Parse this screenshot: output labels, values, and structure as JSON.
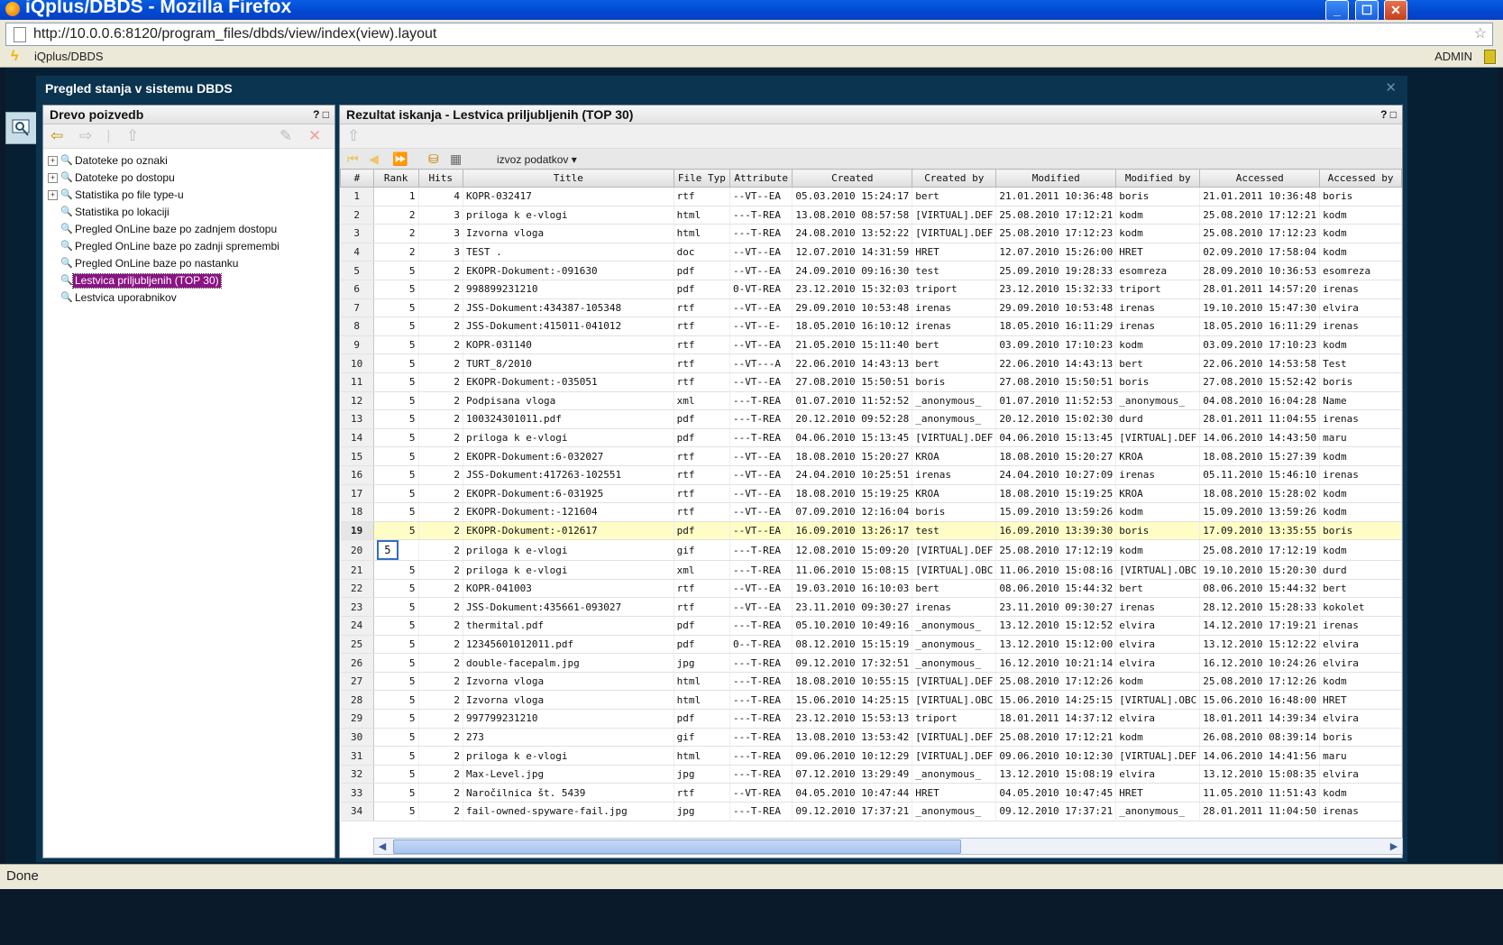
{
  "window": {
    "title": "iQplus/DBDS - Mozilla Firefox"
  },
  "browser": {
    "url": "http://10.0.0.6:8120/program_files/dbds/view/index(view).layout",
    "app_label": "iQplus/DBDS",
    "user": "ADMIN",
    "status": "Done"
  },
  "main_window": {
    "title": "Pregled stanja v sistemu DBDS"
  },
  "left_panel": {
    "title": "Drevo poizvedb",
    "help": "?",
    "items": [
      {
        "label": "Datoteke po oznaki",
        "expandable": "+"
      },
      {
        "label": "Datoteke po dostopu",
        "expandable": "+"
      },
      {
        "label": "Statistika po file type-u",
        "expandable": "+"
      },
      {
        "label": "Statistika po lokaciji",
        "expandable": ""
      },
      {
        "label": "Pregled OnLine baze po zadnjem dostopu",
        "expandable": ""
      },
      {
        "label": "Pregled OnLine baze po zadnji spremembi",
        "expandable": ""
      },
      {
        "label": "Pregled OnLine baze po nastanku",
        "expandable": ""
      },
      {
        "label": "Lestvica priljubljenih (TOP 30)",
        "expandable": ""
      },
      {
        "label": "Lestvica uporabnikov",
        "expandable": ""
      }
    ],
    "selected_index": 7
  },
  "right_panel": {
    "title": "Rezultat iskanja - Lestvica priljubljenih (TOP 30)",
    "help": "?",
    "export_label": "izvoz podatkov"
  },
  "grid": {
    "columns": [
      "#",
      "Rank",
      "Hits",
      "Title",
      "File Typ",
      "Attribute",
      "Created",
      "Created by",
      "Modified",
      "Modified by",
      "Accessed",
      "Accessed by"
    ],
    "highlight_row": 19,
    "focus_row": 20,
    "rows": [
      [
        "1",
        "1",
        "4",
        "KOPR-032417",
        "rtf",
        "--VT--EA",
        "05.03.2010 15:24:17",
        "bert",
        "21.01.2011 10:36:48",
        "boris",
        "21.01.2011 10:36:48",
        "boris"
      ],
      [
        "2",
        "2",
        "3",
        "priloga k e-vlogi",
        "html",
        "---T-REA",
        "13.08.2010 08:57:58",
        "[VIRTUAL].DEF",
        "25.08.2010 17:12:21",
        "kodm",
        "25.08.2010 17:12:21",
        "kodm"
      ],
      [
        "3",
        "2",
        "3",
        "Izvorna vloga",
        "html",
        "---T-REA",
        "24.08.2010 13:52:22",
        "[VIRTUAL].DEF",
        "25.08.2010 17:12:23",
        "kodm",
        "25.08.2010 17:12:23",
        "kodm"
      ],
      [
        "4",
        "2",
        "3",
        "TEST .",
        "doc",
        "--VT--EA",
        "12.07.2010 14:31:59",
        "HRET",
        "12.07.2010 15:26:00",
        "HRET",
        "02.09.2010 17:58:04",
        "kodm"
      ],
      [
        "5",
        "5",
        "2",
        "EKOPR-Dokument:-091630",
        "pdf",
        "--VT--EA",
        "24.09.2010 09:16:30",
        "test",
        "25.09.2010 19:28:33",
        "esomreza",
        "28.09.2010 10:36:53",
        "esomreza"
      ],
      [
        "6",
        "5",
        "2",
        "998899231210",
        "pdf",
        "0-VT-REA",
        "23.12.2010 15:32:03",
        "triport",
        "23.12.2010 15:32:33",
        "triport",
        "28.01.2011 14:57:20",
        "irenas"
      ],
      [
        "7",
        "5",
        "2",
        "JSS-Dokument:434387-105348",
        "rtf",
        "--VT--EA",
        "29.09.2010 10:53:48",
        "irenas",
        "29.09.2010 10:53:48",
        "irenas",
        "19.10.2010 15:47:30",
        "elvira"
      ],
      [
        "8",
        "5",
        "2",
        "JSS-Dokument:415011-041012",
        "rtf",
        "--VT--E-",
        "18.05.2010 16:10:12",
        "irenas",
        "18.05.2010 16:11:29",
        "irenas",
        "18.05.2010 16:11:29",
        "irenas"
      ],
      [
        "9",
        "5",
        "2",
        "KOPR-031140",
        "rtf",
        "--VT--EA",
        "21.05.2010 15:11:40",
        "bert",
        "03.09.2010 17:10:23",
        "kodm",
        "03.09.2010 17:10:23",
        "kodm"
      ],
      [
        "10",
        "5",
        "2",
        "TURT_8/2010",
        "rtf",
        "--VT---A",
        "22.06.2010 14:43:13",
        "bert",
        "22.06.2010 14:43:13",
        "bert",
        "22.06.2010 14:53:58",
        "Test"
      ],
      [
        "11",
        "5",
        "2",
        "EKOPR-Dokument:-035051",
        "rtf",
        "--VT--EA",
        "27.08.2010 15:50:51",
        "boris",
        "27.08.2010 15:50:51",
        "boris",
        "27.08.2010 15:52:42",
        "boris"
      ],
      [
        "12",
        "5",
        "2",
        "Podpisana vloga",
        "xml",
        "---T-REA",
        "01.07.2010 11:52:52",
        "_anonymous_",
        "01.07.2010 11:52:53",
        "_anonymous_",
        "04.08.2010 16:04:28",
        "Name"
      ],
      [
        "13",
        "5",
        "2",
        "100324301011.pdf",
        "pdf",
        "---T-REA",
        "20.12.2010 09:52:28",
        "_anonymous_",
        "20.12.2010 15:02:30",
        "durd",
        "28.01.2011 11:04:55",
        "irenas"
      ],
      [
        "14",
        "5",
        "2",
        "priloga k e-vlogi",
        "pdf",
        "---T-REA",
        "04.06.2010 15:13:45",
        "[VIRTUAL].DEF",
        "04.06.2010 15:13:45",
        "[VIRTUAL].DEF",
        "14.06.2010 14:43:50",
        "maru"
      ],
      [
        "15",
        "5",
        "2",
        "EKOPR-Dokument:6-032027",
        "rtf",
        "--VT--EA",
        "18.08.2010 15:20:27",
        "KROA",
        "18.08.2010 15:20:27",
        "KROA",
        "18.08.2010 15:27:39",
        "kodm"
      ],
      [
        "16",
        "5",
        "2",
        "JSS-Dokument:417263-102551",
        "rtf",
        "--VT--EA",
        "24.04.2010 10:25:51",
        "irenas",
        "24.04.2010 10:27:09",
        "irenas",
        "05.11.2010 15:46:10",
        "irenas"
      ],
      [
        "17",
        "5",
        "2",
        "EKOPR-Dokument:6-031925",
        "rtf",
        "--VT--EA",
        "18.08.2010 15:19:25",
        "KROA",
        "18.08.2010 15:19:25",
        "KROA",
        "18.08.2010 15:28:02",
        "kodm"
      ],
      [
        "18",
        "5",
        "2",
        "EKOPR-Dokument:-121604",
        "rtf",
        "--VT--EA",
        "07.09.2010 12:16:04",
        "boris",
        "15.09.2010 13:59:26",
        "kodm",
        "15.09.2010 13:59:26",
        "kodm"
      ],
      [
        "19",
        "5",
        "2",
        "EKOPR-Dokument:-012617",
        "pdf",
        "--VT--EA",
        "16.09.2010 13:26:17",
        "test",
        "16.09.2010 13:39:30",
        "boris",
        "17.09.2010 13:35:55",
        "boris"
      ],
      [
        "20",
        "5",
        "2",
        "priloga k e-vlogi",
        "gif",
        "---T-REA",
        "12.08.2010 15:09:20",
        "[VIRTUAL].DEF",
        "25.08.2010 17:12:19",
        "kodm",
        "25.08.2010 17:12:19",
        "kodm"
      ],
      [
        "21",
        "5",
        "2",
        "priloga k e-vlogi",
        "xml",
        "---T-REA",
        "11.06.2010 15:08:15",
        "[VIRTUAL].OBC",
        "11.06.2010 15:08:16",
        "[VIRTUAL].OBC",
        "19.10.2010 15:20:30",
        "durd"
      ],
      [
        "22",
        "5",
        "2",
        "KOPR-041003",
        "rtf",
        "--VT--EA",
        "19.03.2010 16:10:03",
        "bert",
        "08.06.2010 15:44:32",
        "bert",
        "08.06.2010 15:44:32",
        "bert"
      ],
      [
        "23",
        "5",
        "2",
        "JSS-Dokument:435661-093027",
        "rtf",
        "--VT--EA",
        "23.11.2010 09:30:27",
        "irenas",
        "23.11.2010 09:30:27",
        "irenas",
        "28.12.2010 15:28:33",
        "kokolet"
      ],
      [
        "24",
        "5",
        "2",
        "thermital.pdf",
        "pdf",
        "---T-REA",
        "05.10.2010 10:49:16",
        "_anonymous_",
        "13.12.2010 15:12:52",
        "elvira",
        "14.12.2010 17:19:21",
        "irenas"
      ],
      [
        "25",
        "5",
        "2",
        "12345601012011.pdf",
        "pdf",
        "0--T-REA",
        "08.12.2010 15:15:19",
        "_anonymous_",
        "13.12.2010 15:12:00",
        "elvira",
        "13.12.2010 15:12:22",
        "elvira"
      ],
      [
        "26",
        "5",
        "2",
        "double-facepalm.jpg",
        "jpg",
        "---T-REA",
        "09.12.2010 17:32:51",
        "_anonymous_",
        "16.12.2010 10:21:14",
        "elvira",
        "16.12.2010 10:24:26",
        "elvira"
      ],
      [
        "27",
        "5",
        "2",
        "Izvorna vloga",
        "html",
        "---T-REA",
        "18.08.2010 10:55:15",
        "[VIRTUAL].DEF",
        "25.08.2010 17:12:26",
        "kodm",
        "25.08.2010 17:12:26",
        "kodm"
      ],
      [
        "28",
        "5",
        "2",
        "Izvorna vloga",
        "html",
        "---T-REA",
        "15.06.2010 14:25:15",
        "[VIRTUAL].OBC",
        "15.06.2010 14:25:15",
        "[VIRTUAL].OBC",
        "15.06.2010 16:48:00",
        "HRET"
      ],
      [
        "29",
        "5",
        "2",
        "997799231210",
        "pdf",
        "---T-REA",
        "23.12.2010 15:53:13",
        "triport",
        "18.01.2011 14:37:12",
        "elvira",
        "18.01.2011 14:39:34",
        "elvira"
      ],
      [
        "30",
        "5",
        "2",
        "273",
        "gif",
        "---T-REA",
        "13.08.2010 13:53:42",
        "[VIRTUAL].DEF",
        "25.08.2010 17:12:21",
        "kodm",
        "26.08.2010 08:39:14",
        "boris"
      ],
      [
        "31",
        "5",
        "2",
        "priloga k e-vlogi",
        "html",
        "---T-REA",
        "09.06.2010 10:12:29",
        "[VIRTUAL].DEF",
        "09.06.2010 10:12:30",
        "[VIRTUAL].DEF",
        "14.06.2010 14:41:56",
        "maru"
      ],
      [
        "32",
        "5",
        "2",
        "Max-Level.jpg",
        "jpg",
        "---T-REA",
        "07.12.2010 13:29:49",
        "_anonymous_",
        "13.12.2010 15:08:19",
        "elvira",
        "13.12.2010 15:08:35",
        "elvira"
      ],
      [
        "33",
        "5",
        "2",
        "Naročilnica št. 5439",
        "rtf",
        "--VT-REA",
        "04.05.2010 10:47:44",
        "HRET",
        "04.05.2010 10:47:45",
        "HRET",
        "11.05.2010 11:51:43",
        "kodm"
      ],
      [
        "34",
        "5",
        "2",
        "fail-owned-spyware-fail.jpg",
        "jpg",
        "---T-REA",
        "09.12.2010 17:37:21",
        "_anonymous_",
        "09.12.2010 17:37:21",
        "_anonymous_",
        "28.01.2011 11:04:50",
        "irenas"
      ]
    ]
  },
  "colors": {
    "accent": "#8a1484",
    "highlight_row": "#fefdc6",
    "panel_header": "#0b3450",
    "titlebar": "#0054e3"
  },
  "icons": [
    "firefox-icon",
    "page-icon",
    "star-icon",
    "bolt-icon",
    "lock-icon",
    "search-panel-icon",
    "back-icon",
    "forward-icon",
    "up-icon",
    "edit-icon",
    "delete-icon",
    "first-page-icon",
    "prev-page-icon",
    "next-page-icon",
    "db-icon",
    "columns-icon",
    "dropdown-icon"
  ]
}
